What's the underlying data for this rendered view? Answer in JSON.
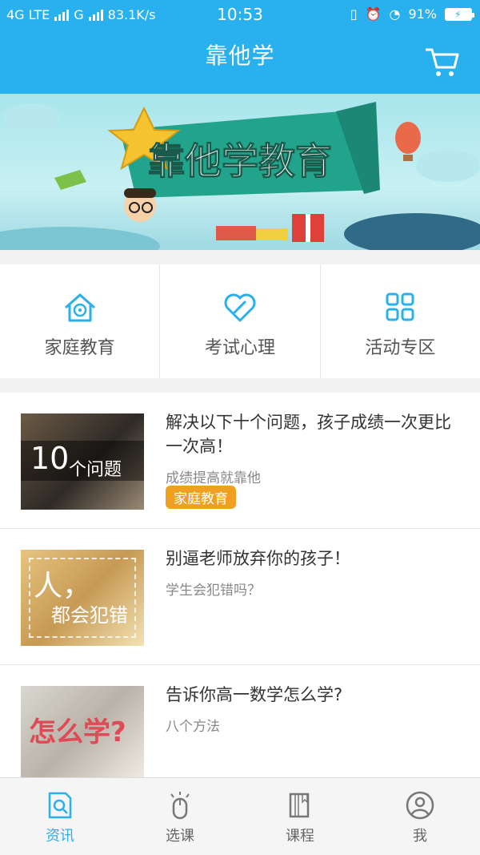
{
  "status": {
    "network1": "4G LTE",
    "network2": "G",
    "speed": "83.1K/s",
    "time": "10:53",
    "battery": "91%"
  },
  "header": {
    "title": "靠他学"
  },
  "banner": {
    "text": "靠他学教育"
  },
  "categories": [
    {
      "label": "家庭教育",
      "icon": "home-brain-icon"
    },
    {
      "label": "考试心理",
      "icon": "heart-pen-icon"
    },
    {
      "label": "活动专区",
      "icon": "grid-icon"
    }
  ],
  "articles": [
    {
      "title": "解决以下十个问题，孩子成绩一次更比一次高！",
      "subtitle": "成绩提高就靠他",
      "tag": "家庭教育",
      "thumb_text_big": "10",
      "thumb_text_small": "个问题"
    },
    {
      "title": "别逼老师放弃你的孩子！",
      "subtitle": "学生会犯错吗？",
      "thumb_text_big": "人，",
      "thumb_text_small": "都会犯错"
    },
    {
      "title": "告诉你高一数学怎么学?",
      "subtitle": "八个方法",
      "thumb_text_big": "怎么学?"
    }
  ],
  "nav": [
    {
      "label": "资讯",
      "icon": "news-search-icon",
      "active": true
    },
    {
      "label": "选课",
      "icon": "mouse-click-icon",
      "active": false
    },
    {
      "label": "课程",
      "icon": "book-icon",
      "active": false
    },
    {
      "label": "我",
      "icon": "user-icon",
      "active": false
    }
  ],
  "colors": {
    "brand": "#29b0ef",
    "tag": "#f0a020"
  }
}
